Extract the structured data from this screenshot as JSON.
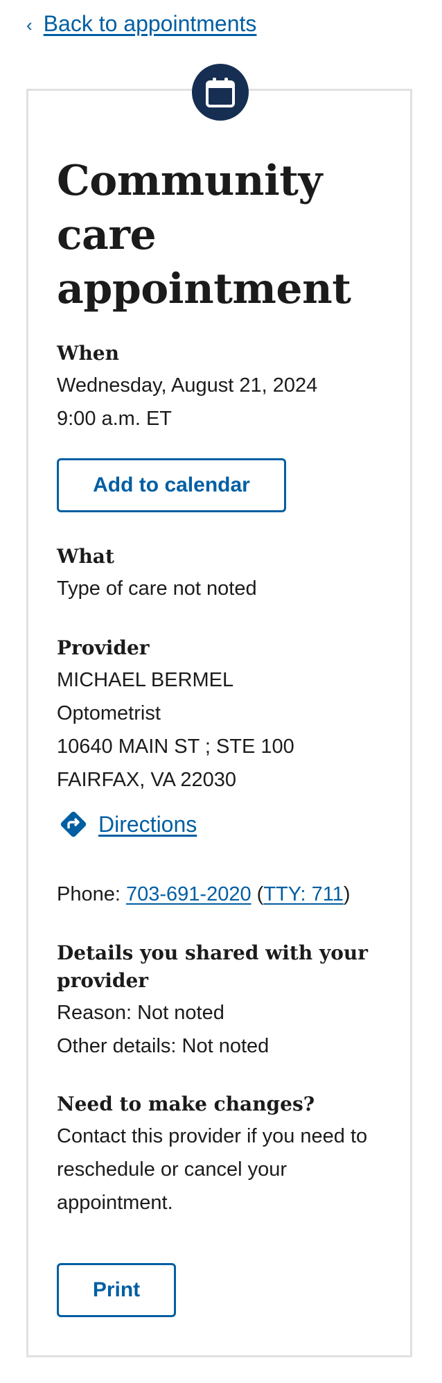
{
  "back_link": {
    "label": "Back to appointments"
  },
  "page_title": "Community care appointment",
  "when": {
    "heading": "When",
    "date": "Wednesday, August 21, 2024",
    "time": "9:00 a.m. ET",
    "add_to_calendar_label": "Add to calendar"
  },
  "what": {
    "heading": "What",
    "value": "Type of care not noted"
  },
  "provider": {
    "heading": "Provider",
    "name": "MICHAEL BERMEL",
    "specialty": "Optometrist",
    "address_line1": "10640 MAIN ST ; STE 100",
    "address_line2": "FAIRFAX, VA 22030",
    "directions_label": "Directions",
    "phone_prefix": "Phone: ",
    "phone": "703-691-2020",
    "tty_open": " (",
    "tty": "TTY: 711",
    "tty_close": ")"
  },
  "details": {
    "heading": "Details you shared with your provider",
    "reason": "Reason: Not noted",
    "other": "Other details: Not noted"
  },
  "changes": {
    "heading": "Need to make changes?",
    "text": "Contact this provider if you need to reschedule or cancel your appointment."
  },
  "print_label": "Print",
  "colors": {
    "link": "#005ea2",
    "badge": "#162e51",
    "card_border": "#dfe1e2",
    "text": "#1b1b1b"
  },
  "icons": {
    "back": "chevron-left-icon",
    "badge": "calendar-icon",
    "directions": "directions-icon"
  }
}
